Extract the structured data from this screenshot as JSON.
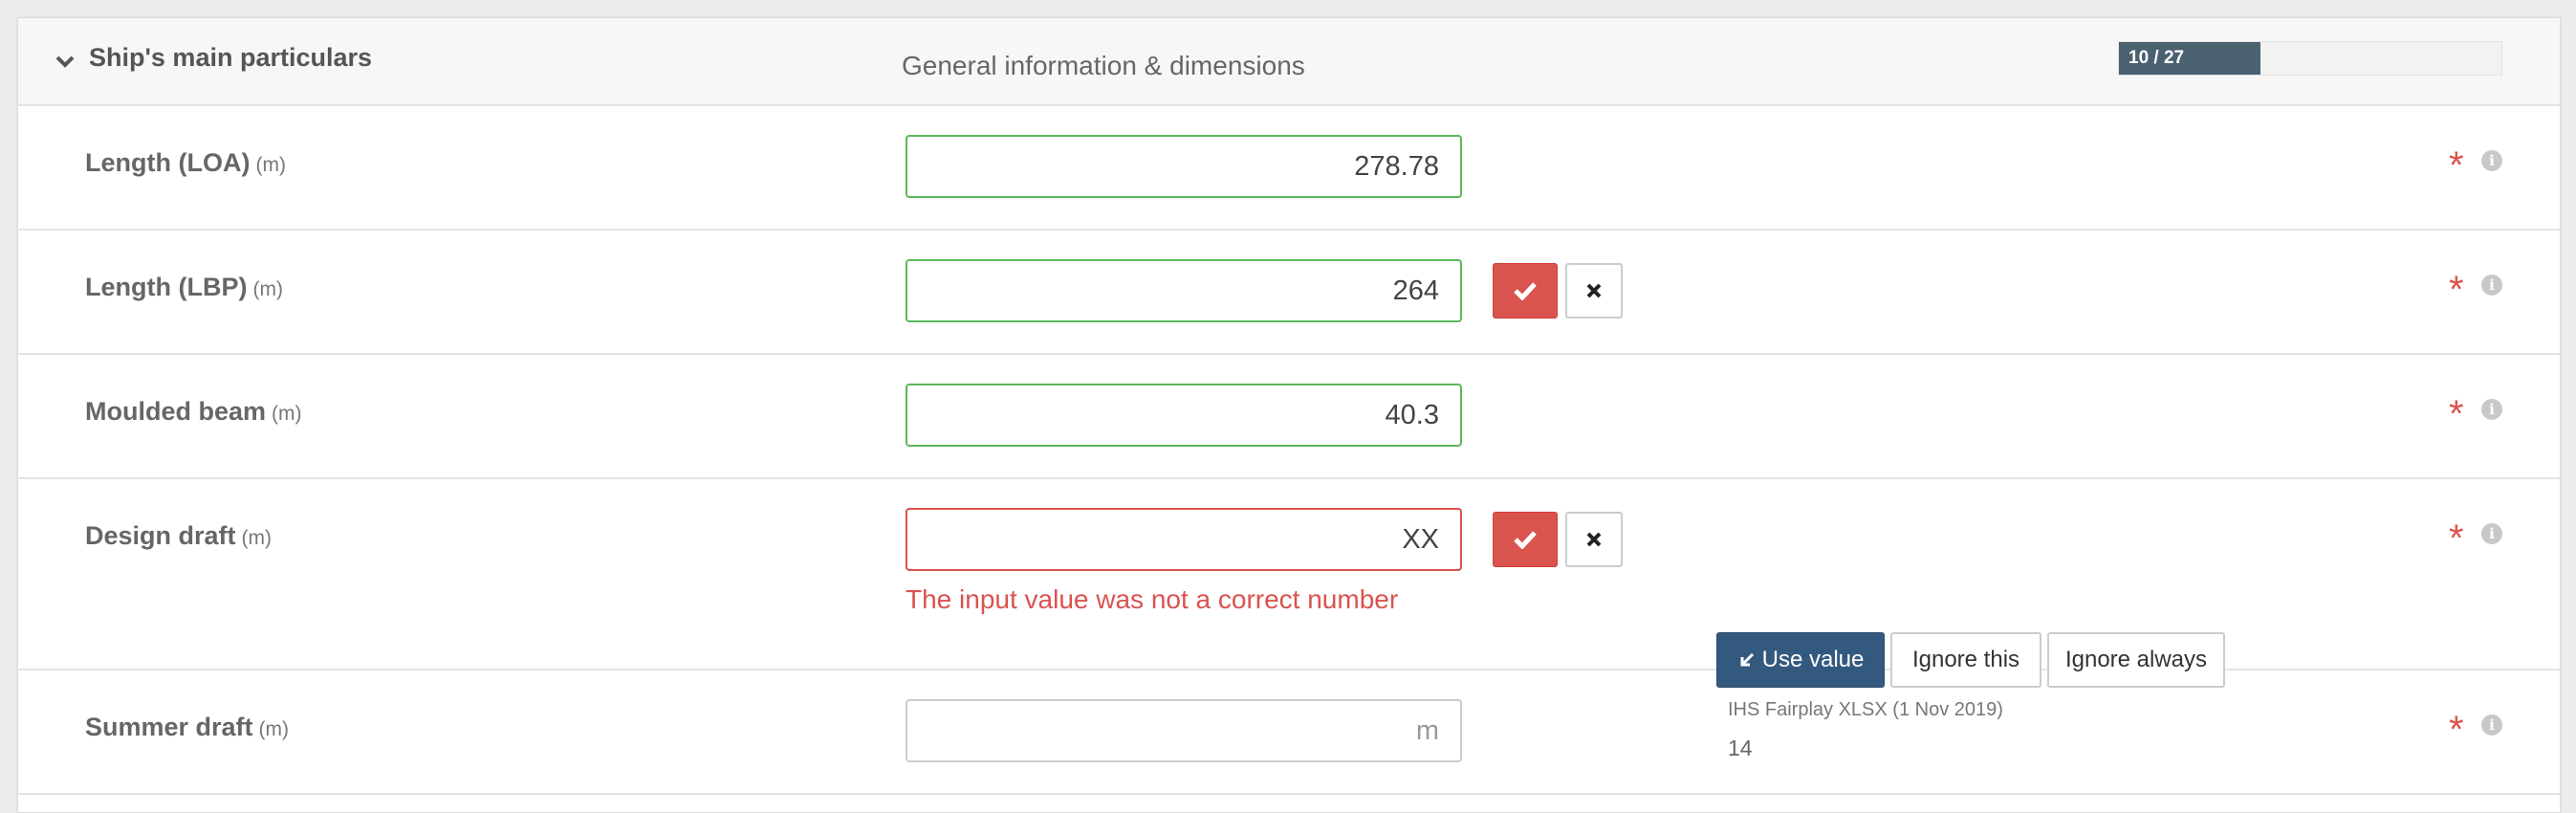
{
  "section": {
    "title": "Ship's main particulars",
    "subtitle": "General information & dimensions",
    "progress_text": "10 / 27",
    "progress_fraction": 0.37
  },
  "rows": [
    {
      "label": "Length (LOA)",
      "unit": "(m)",
      "value": "278.78"
    },
    {
      "label": "Length (LBP)",
      "unit": "(m)",
      "value": "264"
    },
    {
      "label": "Moulded beam",
      "unit": "(m)",
      "value": "40.3"
    },
    {
      "label": "Design draft",
      "unit": "(m)",
      "value": "XX",
      "error": "The input value was not a correct number"
    },
    {
      "label": "Summer draft",
      "unit": "(m)",
      "placeholder": "m"
    }
  ],
  "suggestion": {
    "use_value_label": "Use value",
    "ignore_this_label": "Ignore this",
    "ignore_always_label": "Ignore always",
    "source": "IHS Fairplay XLSX (1 Nov 2019)",
    "value": "14"
  },
  "icons": {
    "collapse": "chevron-down-icon",
    "confirm": "check-icon",
    "reject": "close-icon",
    "required": "asterisk-icon",
    "info": "info-icon",
    "use_value": "arrow-down-left-icon"
  },
  "colors": {
    "valid_border": "#5cb85c",
    "error": "#d9534f",
    "primary": "#34597f",
    "progress": "#4a6170"
  }
}
